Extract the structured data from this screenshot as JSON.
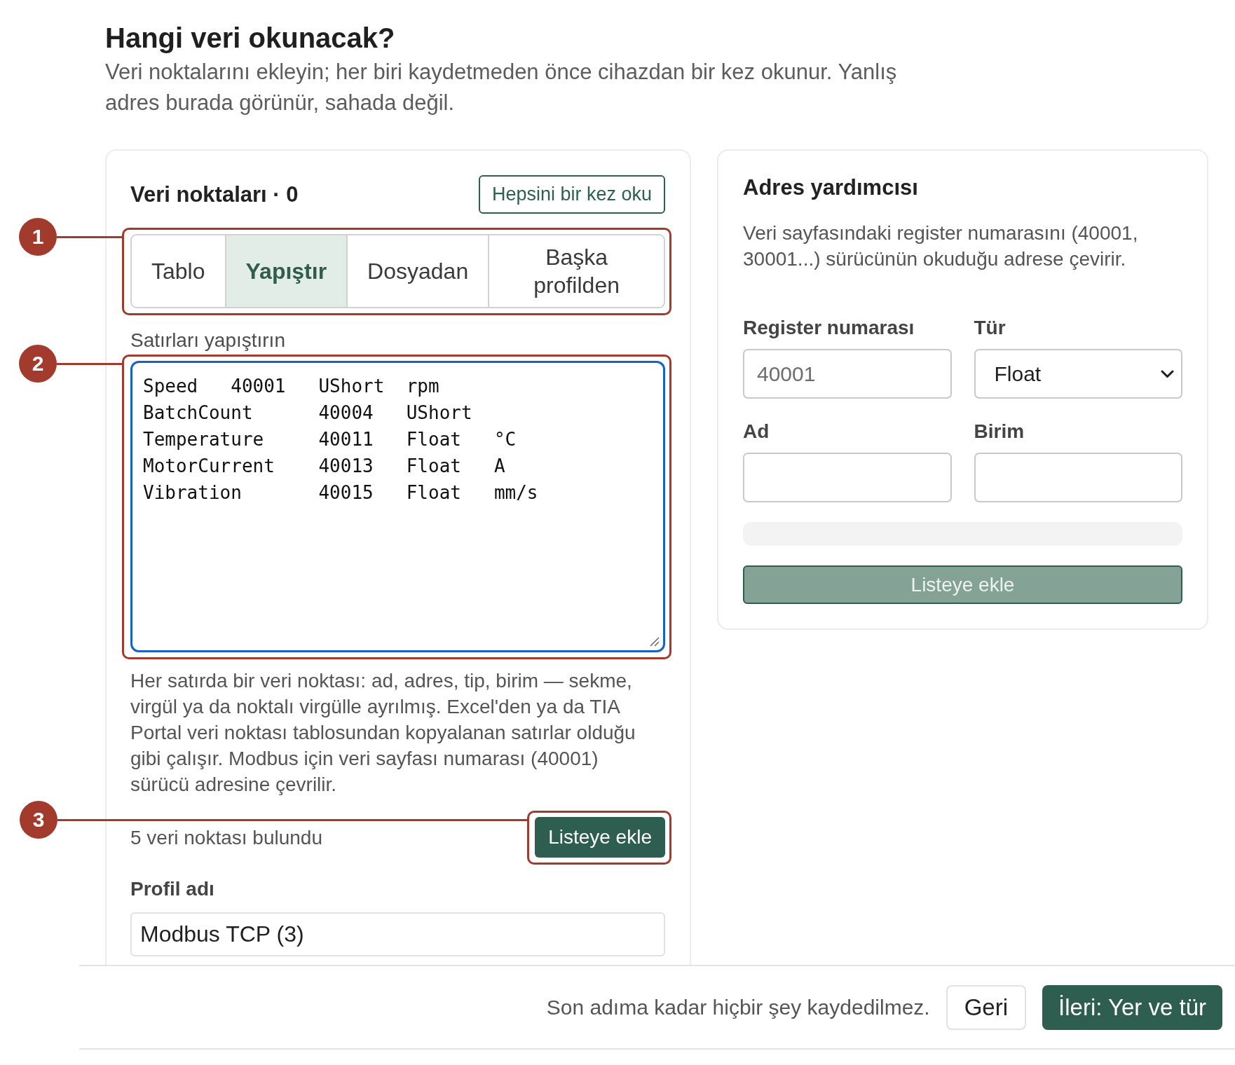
{
  "page": {
    "title": "Hangi veri okunacak?",
    "subtitle": "Veri noktalarını ekleyin; her biri kaydetmeden önce cihazdan bir kez okunur. Yanlış adres burada görünür, sahada değil."
  },
  "data_points": {
    "title": "Veri noktaları · 0",
    "read_all_button": "Hepsini bir kez oku",
    "tabs_callout": "1",
    "tabs": [
      {
        "label": "Tablo",
        "selected": false
      },
      {
        "label": "Yapıştır",
        "selected": true
      },
      {
        "label": "Dosyadan",
        "selected": false
      },
      {
        "label": "Başka profilden",
        "selected": false
      }
    ],
    "paste_label": "Satırları yapıştırın",
    "paste_callout": "2",
    "paste_value": "Speed\t40001\tUShort\trpm\nBatchCount\t40004\tUShort\nTemperature\t40011\tFloat\t°C\nMotorCurrent\t40013\tFloat\tA\nVibration\t40015\tFloat\tmm/s",
    "help": "Her satırda bir veri noktası: ad, adres, tip, birim — sekme, virgül ya da noktalı virgülle ayrılmış. Excel'den ya da TIA Portal veri noktası tablosundan kopyalanan satırlar olduğu gibi çalışır. Modbus için veri sayfası numarası (40001) sürücü adresine çevrilir.",
    "found": "5 veri noktası bulundu",
    "add_callout": "3",
    "add_button": "Listeye ekle",
    "profile_label": "Profil adı",
    "profile_value": "Modbus TCP (3)"
  },
  "address_helper": {
    "title": "Adres yardımcısı",
    "description": "Veri sayfasındaki register numarasını (40001, 30001...) sürücünün okuduğu adrese çevirir.",
    "fields": [
      {
        "kind": "text",
        "label": "Register numarası",
        "placeholder": "40001"
      },
      {
        "kind": "select",
        "label": "Tür",
        "value": "Float"
      },
      {
        "kind": "text",
        "label": "Ad"
      },
      {
        "kind": "text",
        "label": "Birim"
      }
    ],
    "add_button": {
      "label": "Listeye ekle",
      "disabled": true
    }
  },
  "footer": {
    "note": "Son adıma kadar hiçbir şey kaydedilmez.",
    "back_button": "Geri",
    "next_button": "İleri: Yer ve tür"
  }
}
